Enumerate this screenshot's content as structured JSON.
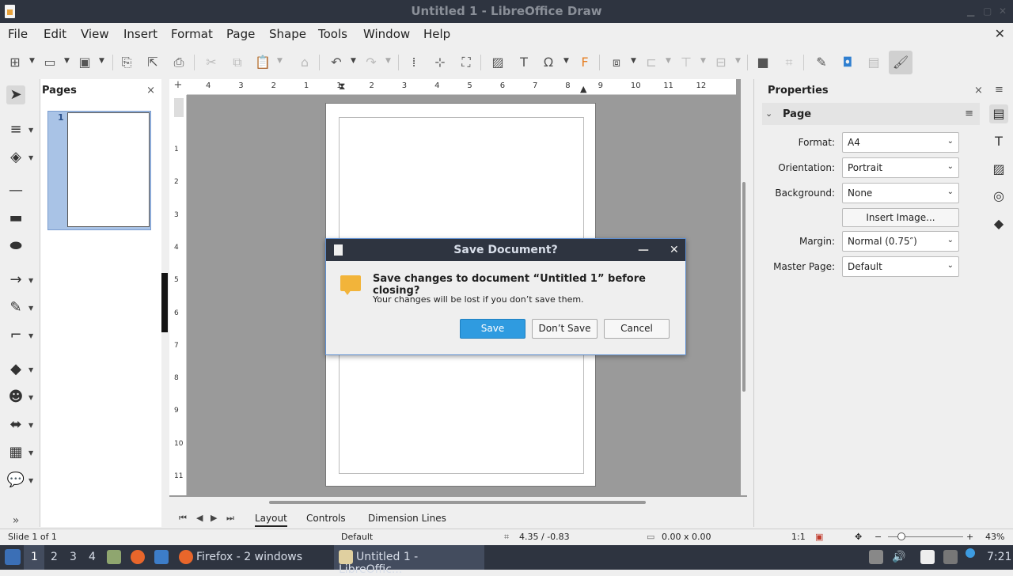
{
  "window": {
    "title": "Untitled 1 - LibreOffice Draw"
  },
  "menubar": [
    "File",
    "Edit",
    "View",
    "Insert",
    "Format",
    "Page",
    "Shape",
    "Tools",
    "Window",
    "Help"
  ],
  "pages_panel": {
    "title": "Pages",
    "page_number": "1"
  },
  "hruler_ticks": [
    "4",
    "3",
    "2",
    "1",
    "1",
    "2",
    "3",
    "4",
    "5",
    "6",
    "7",
    "8",
    "9",
    "10",
    "11",
    "12"
  ],
  "vruler_ticks": [
    "1",
    "2",
    "3",
    "4",
    "5",
    "6",
    "7",
    "8",
    "9",
    "10",
    "11"
  ],
  "tabs": [
    "Layout",
    "Controls",
    "Dimension Lines"
  ],
  "properties": {
    "title": "Properties",
    "section": "Page",
    "rows": [
      {
        "label": "Format:",
        "value": "A4"
      },
      {
        "label": "Orientation:",
        "value": "Portrait"
      },
      {
        "label": "Background:",
        "value": "None"
      },
      {
        "label": "",
        "button": "Insert Image..."
      },
      {
        "label": "Margin:",
        "value": "Normal (0.75″)"
      },
      {
        "label": "Master Page:",
        "value": "Default"
      }
    ]
  },
  "dialog": {
    "title": "Save Document?",
    "primary": "Save changes to document “Untitled 1” before closing?",
    "secondary": "Your changes will be lost if you don’t save them.",
    "buttons": {
      "save": "Save",
      "dont_save": "Don’t Save",
      "cancel": "Cancel"
    }
  },
  "status": {
    "slide": "Slide 1 of 1",
    "master": "Default",
    "position": "4.35 / -0.83",
    "size": "0.00 x 0.00",
    "scale": "1:1",
    "zoom": "43%"
  },
  "taskbar": {
    "workspaces": [
      "1",
      "2",
      "3",
      "4"
    ],
    "firefox": "Firefox - 2 windows",
    "libreoffice": "Untitled 1 - LibreOffic...",
    "clock": "7:21"
  },
  "colors": {
    "accent": "#2f9be0",
    "titlebar": "#2e3440",
    "canvas": "#9a9a9a"
  }
}
